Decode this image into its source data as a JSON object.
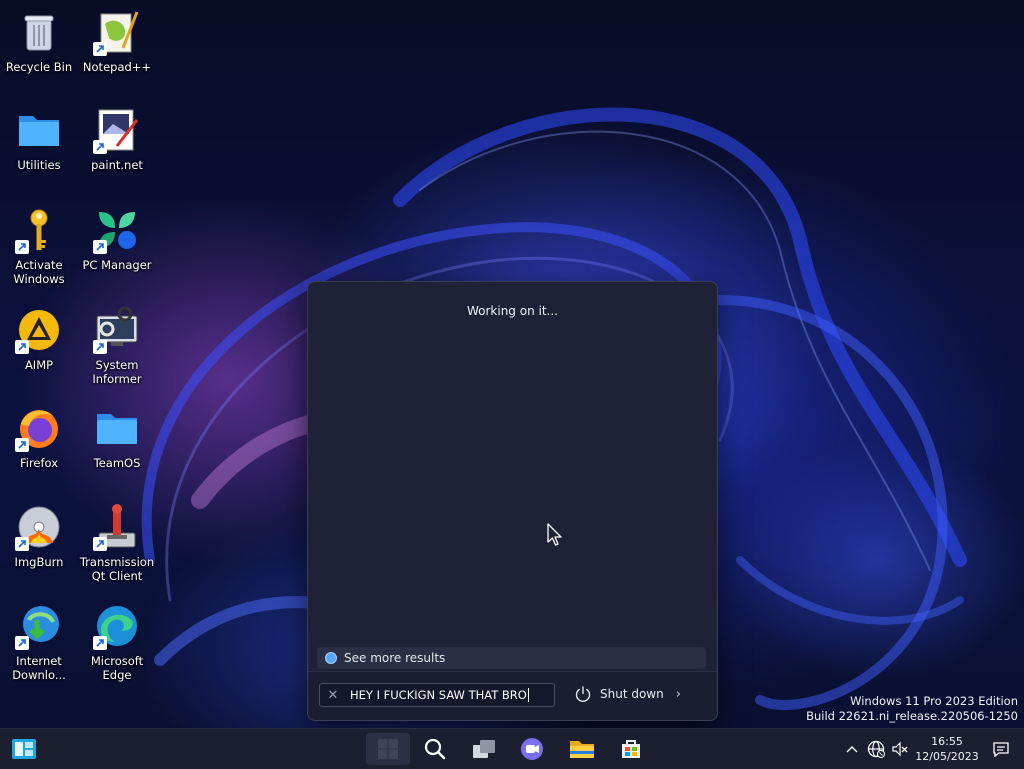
{
  "desktop": {
    "icons": [
      {
        "label": "Recycle Bin",
        "icon": "recycle-bin-icon"
      },
      {
        "label": "Notepad++",
        "icon": "notepad-plus-plus-icon",
        "shortcut": true
      },
      {
        "label": "Utilities",
        "icon": "folder-icon"
      },
      {
        "label": "paint.net",
        "icon": "paint-net-icon",
        "shortcut": true
      },
      {
        "label": "Activate Windows",
        "icon": "key-icon",
        "shortcut": true
      },
      {
        "label": "PC Manager",
        "icon": "pc-manager-icon",
        "shortcut": true
      },
      {
        "label": "AIMP",
        "icon": "aimp-icon",
        "shortcut": true
      },
      {
        "label": "System Informer",
        "icon": "system-informer-icon",
        "shortcut": true
      },
      {
        "label": "Firefox",
        "icon": "firefox-icon",
        "shortcut": true
      },
      {
        "label": "TeamOS",
        "icon": "folder-icon"
      },
      {
        "label": "ImgBurn",
        "icon": "imgburn-icon",
        "shortcut": true
      },
      {
        "label": "Transmission Qt Client",
        "icon": "transmission-icon",
        "shortcut": true
      },
      {
        "label": "Internet Downlo...",
        "icon": "internet-download-manager-icon",
        "shortcut": true
      },
      {
        "label": "Microsoft Edge",
        "icon": "edge-icon",
        "shortcut": true
      }
    ]
  },
  "start_panel": {
    "status_text": "Working on it...",
    "see_more_label": "See more results",
    "search_value": "HEY I FUCKIGN SAW THAT BRO",
    "shutdown_label": "Shut down"
  },
  "watermark": {
    "line1": "Windows 11 Pro 2023 Edition",
    "line2": "Build 22621.ni_release.220506-1250"
  },
  "taskbar": {
    "clock_time": "16:55",
    "clock_date": "12/05/2023"
  },
  "colors": {
    "accent": "#5aa7ff",
    "panel_bg": "#1f2237",
    "taskbar_bg": "#1c1f30"
  }
}
